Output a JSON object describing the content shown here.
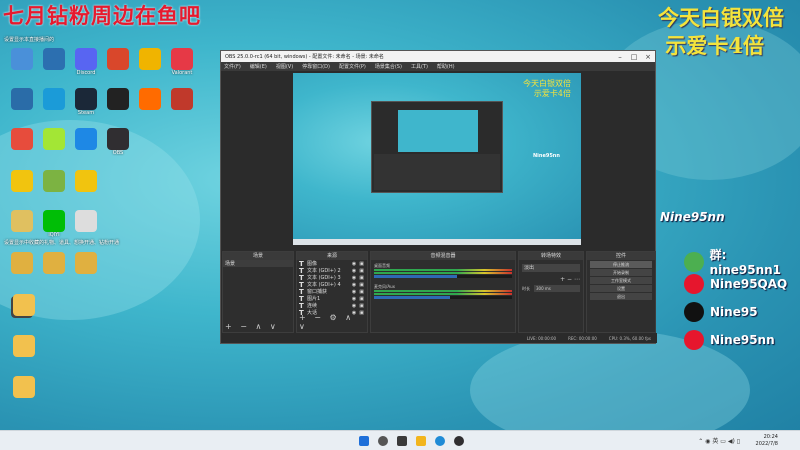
{
  "overlay": {
    "top_left_red": "七月钻粉周边在鱼吧",
    "top_right_line1": "今天白银双倍",
    "top_right_line2": "示爱卡4倍"
  },
  "desktop_icons": [
    {
      "label": "",
      "color": "#4a90d9"
    },
    {
      "label": "",
      "color": "#2c6fb0"
    },
    {
      "label": "Discord",
      "color": "#5865f2"
    },
    {
      "label": "",
      "color": "#d9472b"
    },
    {
      "label": "",
      "color": "#f0b400"
    },
    {
      "label": "Valorant",
      "color": "#e63946"
    },
    {
      "label": "",
      "color": "#2a6ca8"
    },
    {
      "label": "",
      "color": "#1b9bd8"
    },
    {
      "label": "Steam",
      "color": "#1b2838"
    },
    {
      "label": "",
      "color": "#222"
    },
    {
      "label": "",
      "color": "#ff6b00"
    },
    {
      "label": "",
      "color": "#c0392b"
    },
    {
      "label": "",
      "color": "#e74c3c"
    },
    {
      "label": "",
      "color": "#a3e635"
    },
    {
      "label": "",
      "color": "#1e88e5"
    },
    {
      "label": "OBS",
      "color": "#302e31"
    },
    {
      "label": "",
      "color": "#f1c40f"
    },
    {
      "label": "",
      "color": "#7cb342"
    },
    {
      "label": "",
      "color": "#f1c40f"
    },
    {
      "label": "",
      "color": "#e0c060"
    },
    {
      "label": "iQIYI",
      "color": "#00be06"
    },
    {
      "label": "",
      "color": "#ddd"
    },
    {
      "label": "",
      "color": "#e0b040"
    },
    {
      "label": "",
      "color": "#e0b040"
    },
    {
      "label": "",
      "color": "#e0b040"
    },
    {
      "label": "",
      "color": "#444"
    }
  ],
  "desktop_notes": {
    "note1": "设置显示本直接播间的",
    "note2": "设置显示中收藏的礼物、道具、想换开通、钻粉开通",
    "note3": "iQIYI"
  },
  "obs": {
    "title": "OBS 25.0.0-rc1 (64 bit, windows) - 配置文件: 未命名 - 场景: 未命名",
    "menu": [
      "文件(F)",
      "编辑(E)",
      "视图(V)",
      "停靠窗口(D)",
      "配置文件(P)",
      "场景集合(S)",
      "工具(T)",
      "帮助(H)"
    ],
    "docks": {
      "scenes": {
        "title": "场景",
        "items": [
          "场景"
        ]
      },
      "sources": {
        "title": "来源",
        "items": [
          "图像",
          "文本 (GDI+) 2",
          "文本 (GDI+) 3",
          "文本 (GDI+) 4",
          "窗口捕获",
          "图片1",
          "连续",
          "大话"
        ]
      },
      "mixer": {
        "title": "音频混音器",
        "tracks": [
          {
            "name": "桌面音频",
            "level": 0.6
          },
          {
            "name": "麦克风/Aux",
            "level": 0.55
          }
        ]
      },
      "transitions": {
        "title": "转场特效",
        "type": "淡出",
        "duration_label": "时长",
        "duration_value": "300 ms"
      },
      "controls": {
        "title": "控件",
        "buttons": [
          "停止推流",
          "开始录制",
          "工作室模式",
          "设置",
          "退出"
        ]
      }
    },
    "status": {
      "live": "LIVE: 00:00:00",
      "rec": "REC: 00:00:00",
      "cpu": "CPU: 0.3%, 60.00 fps"
    },
    "preview_overlay": {
      "line1": "今天白银双倍",
      "line2": "示爱卡4倍"
    },
    "preview_handle": "Nine95nn"
  },
  "social": {
    "handle": "Nine95nn",
    "items": [
      {
        "platform": "wechat-icon",
        "text": "群: nine95nn1",
        "color": "#4caf50"
      },
      {
        "platform": "weibo-icon",
        "text": "Nine95QAQ",
        "color": "#e6162d"
      },
      {
        "platform": "tiktok-icon",
        "text": "Nine95",
        "color": "#111"
      },
      {
        "platform": "weibo-icon",
        "text": "Nine95nn",
        "color": "#e6162d"
      }
    ]
  },
  "taskbar": {
    "time": "20:24",
    "date": "2022/7/8",
    "lang": "英"
  }
}
